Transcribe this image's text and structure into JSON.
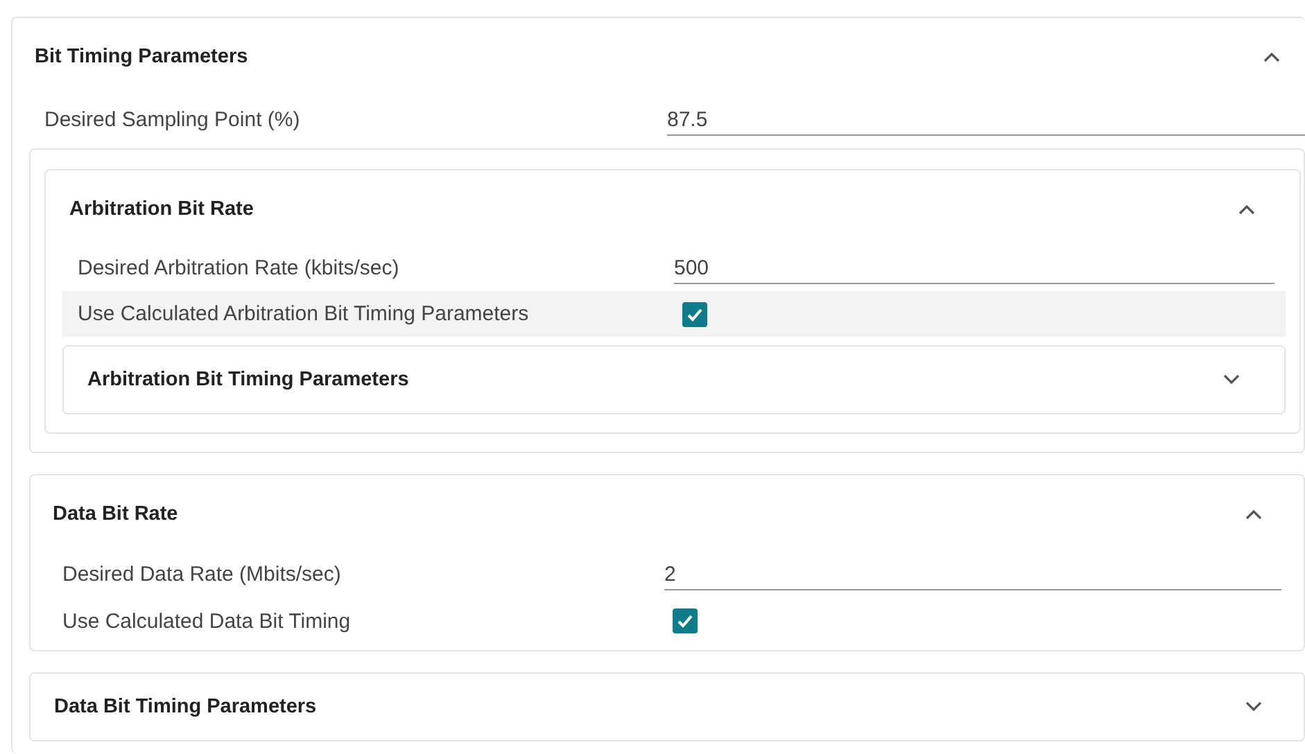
{
  "panel": {
    "title": "Bit Timing Parameters",
    "expanded": true,
    "items": [
      {
        "kind": "field",
        "label": "Desired Sampling Point (%)",
        "value": "87.5"
      },
      {
        "kind": "group",
        "panels": [
          {
            "title": "Arbitration Bit Rate",
            "expanded": true,
            "items": [
              {
                "kind": "field",
                "label": "Desired Arbitration Rate (kbits/sec)",
                "value": "500"
              },
              {
                "kind": "checkbox",
                "label": "Use Calculated Arbitration Bit Timing Parameters",
                "checked": true,
                "hovered": true
              },
              {
                "kind": "panel",
                "title": "Arbitration Bit Timing Parameters",
                "expanded": false
              }
            ]
          }
        ]
      },
      {
        "kind": "panel",
        "title": "Data Bit Rate",
        "expanded": true,
        "items": [
          {
            "kind": "field",
            "label": "Desired Data Rate (Mbits/sec)",
            "value": "2"
          },
          {
            "kind": "checkbox",
            "label": "Use Calculated Data Bit Timing",
            "checked": true,
            "hovered": false
          }
        ]
      },
      {
        "kind": "panel",
        "title": "Data Bit Timing Parameters",
        "expanded": false
      }
    ]
  }
}
